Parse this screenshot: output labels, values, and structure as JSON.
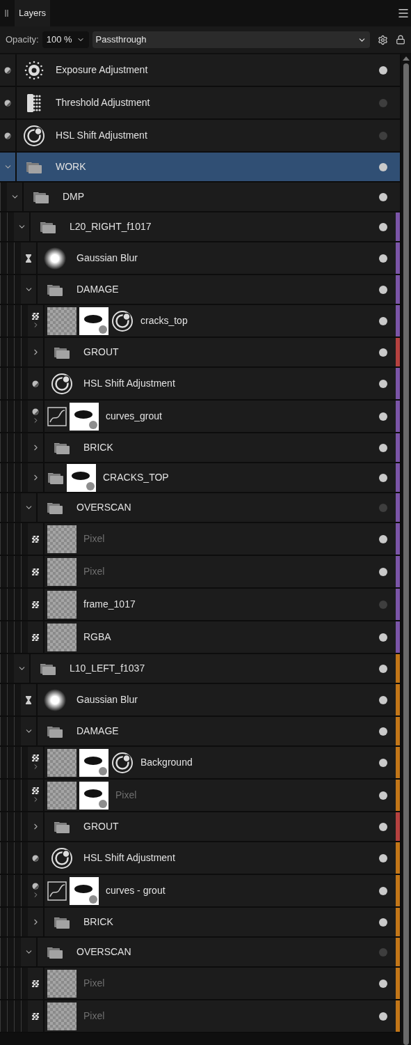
{
  "panel": {
    "tab": "Layers"
  },
  "toolbar": {
    "opacity_label": "Opacity:",
    "opacity": "100 %",
    "blend_mode": "Passthrough"
  },
  "layers": [
    {
      "name": "Exposure Adjustment",
      "kind": "adjustment",
      "thumbs": [
        {
          "kind": "exposure"
        }
      ],
      "visible": true,
      "selected": false
    },
    {
      "name": "Threshold Adjustment",
      "kind": "adjustment",
      "thumbs": [
        {
          "kind": "threshold"
        }
      ],
      "visible": false,
      "selected": false
    },
    {
      "name": "HSL Shift Adjustment",
      "kind": "adjustment",
      "thumbs": [
        {
          "kind": "hsl"
        }
      ],
      "visible": false,
      "selected": false
    },
    {
      "name": "WORK",
      "kind": "group",
      "thumbs": [
        {
          "kind": "folder"
        }
      ],
      "visible": true,
      "selected": true,
      "expanded": true,
      "children": [
        {
          "name": "DMP",
          "kind": "group",
          "thumbs": [
            {
              "kind": "folder"
            }
          ],
          "visible": true,
          "selected": false,
          "expanded": true,
          "children": [
            {
              "name": "L20_RIGHT_f1017",
              "kind": "group",
              "thumbs": [
                {
                  "kind": "folder"
                }
              ],
              "visible": true,
              "selected": false,
              "expanded": true,
              "color": "#7b55a8",
              "children": [
                {
                  "name": "Gaussian Blur",
                  "kind": "filter",
                  "thumbs": [
                    {
                      "kind": "blur"
                    }
                  ],
                  "visible": true,
                  "selected": false,
                  "color": "#7b55a8"
                },
                {
                  "name": "DAMAGE",
                  "kind": "group",
                  "thumbs": [
                    {
                      "kind": "folder"
                    }
                  ],
                  "visible": true,
                  "selected": false,
                  "expanded": true,
                  "color": "#7b55a8",
                  "children": [
                    {
                      "name": "cracks_top",
                      "kind": "pixel",
                      "thumbs": [
                        {
                          "kind": "pixel"
                        },
                        {
                          "kind": "mask"
                        },
                        {
                          "kind": "hsl"
                        }
                      ],
                      "visible": true,
                      "selected": false,
                      "expanded": false,
                      "color": "#7b55a8"
                    },
                    {
                      "name": "GROUT",
                      "kind": "group",
                      "thumbs": [
                        {
                          "kind": "folder"
                        }
                      ],
                      "visible": true,
                      "selected": false,
                      "expanded": false,
                      "color": "#b5413f"
                    },
                    {
                      "name": "HSL Shift Adjustment",
                      "kind": "adjustment",
                      "thumbs": [
                        {
                          "kind": "hsl"
                        }
                      ],
                      "visible": true,
                      "selected": false,
                      "color": "#7b55a8"
                    },
                    {
                      "name": "curves_grout",
                      "kind": "adjustment",
                      "thumbs": [
                        {
                          "kind": "curves"
                        },
                        {
                          "kind": "mask"
                        }
                      ],
                      "visible": true,
                      "selected": false,
                      "expanded": false,
                      "color": "#7b55a8"
                    },
                    {
                      "name": "BRICK",
                      "kind": "group",
                      "thumbs": [
                        {
                          "kind": "folder"
                        }
                      ],
                      "visible": true,
                      "selected": false,
                      "expanded": false,
                      "color": "#7b55a8"
                    },
                    {
                      "name": "CRACKS_TOP",
                      "kind": "group",
                      "thumbs": [
                        {
                          "kind": "folder"
                        },
                        {
                          "kind": "mask"
                        }
                      ],
                      "visible": true,
                      "selected": false,
                      "expanded": false,
                      "color": "#7b55a8"
                    }
                  ]
                },
                {
                  "name": "OVERSCAN",
                  "kind": "group",
                  "thumbs": [
                    {
                      "kind": "folder"
                    }
                  ],
                  "visible": false,
                  "selected": false,
                  "expanded": true,
                  "color": "#7b55a8",
                  "children": [
                    {
                      "name": "Pixel",
                      "kind": "pixel",
                      "thumbs": [
                        {
                          "kind": "pixel"
                        }
                      ],
                      "visible": true,
                      "greyed": true,
                      "selected": false,
                      "color": "#7b55a8"
                    },
                    {
                      "name": "Pixel",
                      "kind": "pixel",
                      "thumbs": [
                        {
                          "kind": "pixel"
                        }
                      ],
                      "visible": true,
                      "greyed": true,
                      "selected": false,
                      "color": "#7b55a8"
                    },
                    {
                      "name": "frame_1017",
                      "kind": "pixel",
                      "thumbs": [
                        {
                          "kind": "pixel"
                        }
                      ],
                      "visible": false,
                      "greyed": false,
                      "selected": false,
                      "color": "#7b55a8"
                    },
                    {
                      "name": "RGBA",
                      "kind": "pixel",
                      "thumbs": [
                        {
                          "kind": "pixel"
                        }
                      ],
                      "visible": true,
                      "greyed": false,
                      "selected": false,
                      "color": "#7b55a8"
                    }
                  ]
                }
              ]
            },
            {
              "name": "L10_LEFT_f1037",
              "kind": "group",
              "thumbs": [
                {
                  "kind": "folder"
                }
              ],
              "visible": true,
              "selected": false,
              "expanded": true,
              "color": "#c27618",
              "children": [
                {
                  "name": "Gaussian Blur",
                  "kind": "filter",
                  "thumbs": [
                    {
                      "kind": "blur"
                    }
                  ],
                  "visible": true,
                  "selected": false,
                  "color": "#c27618"
                },
                {
                  "name": "DAMAGE",
                  "kind": "group",
                  "thumbs": [
                    {
                      "kind": "folder"
                    }
                  ],
                  "visible": true,
                  "selected": false,
                  "expanded": true,
                  "color": "#c27618",
                  "children": [
                    {
                      "name": "Background",
                      "kind": "pixel",
                      "thumbs": [
                        {
                          "kind": "pixel"
                        },
                        {
                          "kind": "mask"
                        },
                        {
                          "kind": "hsl"
                        }
                      ],
                      "visible": true,
                      "greyed": false,
                      "selected": false,
                      "expanded": false,
                      "color": "#c27618"
                    },
                    {
                      "name": "Pixel",
                      "kind": "pixel",
                      "thumbs": [
                        {
                          "kind": "pixel"
                        },
                        {
                          "kind": "mask"
                        }
                      ],
                      "visible": true,
                      "greyed": true,
                      "selected": false,
                      "expanded": false,
                      "color": "#c27618"
                    },
                    {
                      "name": "GROUT",
                      "kind": "group",
                      "thumbs": [
                        {
                          "kind": "folder"
                        }
                      ],
                      "visible": true,
                      "selected": false,
                      "expanded": false,
                      "color": "#b5413f"
                    },
                    {
                      "name": "HSL Shift Adjustment",
                      "kind": "adjustment",
                      "thumbs": [
                        {
                          "kind": "hsl"
                        }
                      ],
                      "visible": true,
                      "selected": false,
                      "color": "#c27618"
                    },
                    {
                      "name": "curves - grout",
                      "kind": "adjustment",
                      "thumbs": [
                        {
                          "kind": "curves"
                        },
                        {
                          "kind": "mask"
                        }
                      ],
                      "visible": true,
                      "selected": false,
                      "expanded": false,
                      "color": "#c27618"
                    },
                    {
                      "name": "BRICK",
                      "kind": "group",
                      "thumbs": [
                        {
                          "kind": "folder"
                        }
                      ],
                      "visible": true,
                      "selected": false,
                      "expanded": false,
                      "color": "#c27618"
                    }
                  ]
                },
                {
                  "name": "OVERSCAN",
                  "kind": "group",
                  "thumbs": [
                    {
                      "kind": "folder"
                    }
                  ],
                  "visible": false,
                  "selected": false,
                  "expanded": true,
                  "color": "#c27618",
                  "children": [
                    {
                      "name": "Pixel",
                      "kind": "pixel",
                      "thumbs": [
                        {
                          "kind": "pixel"
                        }
                      ],
                      "visible": true,
                      "greyed": true,
                      "selected": false,
                      "color": "#c27618"
                    },
                    {
                      "name": "Pixel",
                      "kind": "pixel",
                      "thumbs": [
                        {
                          "kind": "pixel"
                        }
                      ],
                      "visible": true,
                      "greyed": true,
                      "selected": false,
                      "color": "#c27618"
                    }
                  ]
                }
              ]
            }
          ]
        }
      ]
    }
  ]
}
